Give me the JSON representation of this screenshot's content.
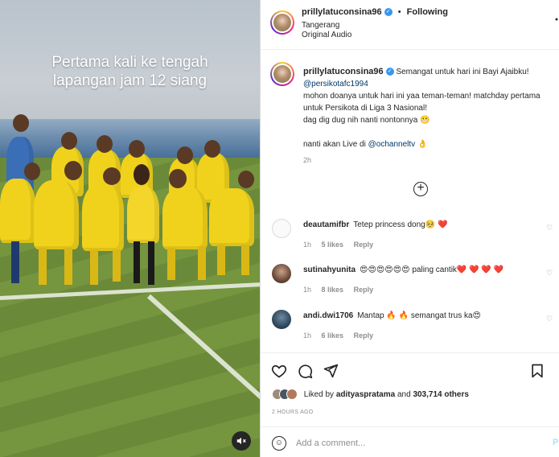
{
  "video": {
    "caption_line1": "Pertama kali ke tengah",
    "caption_line2": "lapangan jam 12 siang",
    "mute_icon": "speaker-muted-icon"
  },
  "header": {
    "username": "prillylatuconsina96",
    "separator": "•",
    "follow_label": "Following",
    "location": "Tangerang",
    "audio": "Original Audio"
  },
  "post_caption": {
    "username": "prillylatuconsina96",
    "line1": "Semangat untuk hari ini Bayi Ajaibku!",
    "mention1": "@persikotafc1994",
    "line3": "mohon doanya untuk hari ini yaa teman-teman! matchday pertama",
    "line4": "untuk Persikota di Liga 3 Nasional!",
    "line5": "dag dig dug nih nanti nontonnya 😬",
    "line6_prefix": "nanti akan Live di",
    "mention2": "@ochanneltv",
    "line6_suffix": "👌",
    "time": "2h"
  },
  "comments": [
    {
      "username": "deautamifbr",
      "text": "Tetep princess dong🥺 ❤️",
      "time": "1h",
      "likes": "5 likes",
      "reply": "Reply"
    },
    {
      "username": "sutinahyunita",
      "text": "😍😍😍😍😍😍 paling cantik❤️ ❤️ ❤️ ❤️",
      "time": "1h",
      "likes": "8 likes",
      "reply": "Reply"
    },
    {
      "username": "andi.dwi1706",
      "text": "Mantap 🔥 🔥 semangat trus ka😍",
      "time": "1h",
      "likes": "6 likes",
      "reply": "Reply"
    }
  ],
  "likes": {
    "prefix": "Liked by",
    "user": "adityaspratama",
    "middle": "and",
    "count": "303,714 others"
  },
  "timestamp": "2 HOURS AGO",
  "add_comment": {
    "placeholder": "Add a comment...",
    "post_label": "P"
  },
  "colors": {
    "link": "#00376b",
    "verified": "#3897f0",
    "muted_text": "#8e8e8e",
    "heart": "#ed4956"
  }
}
